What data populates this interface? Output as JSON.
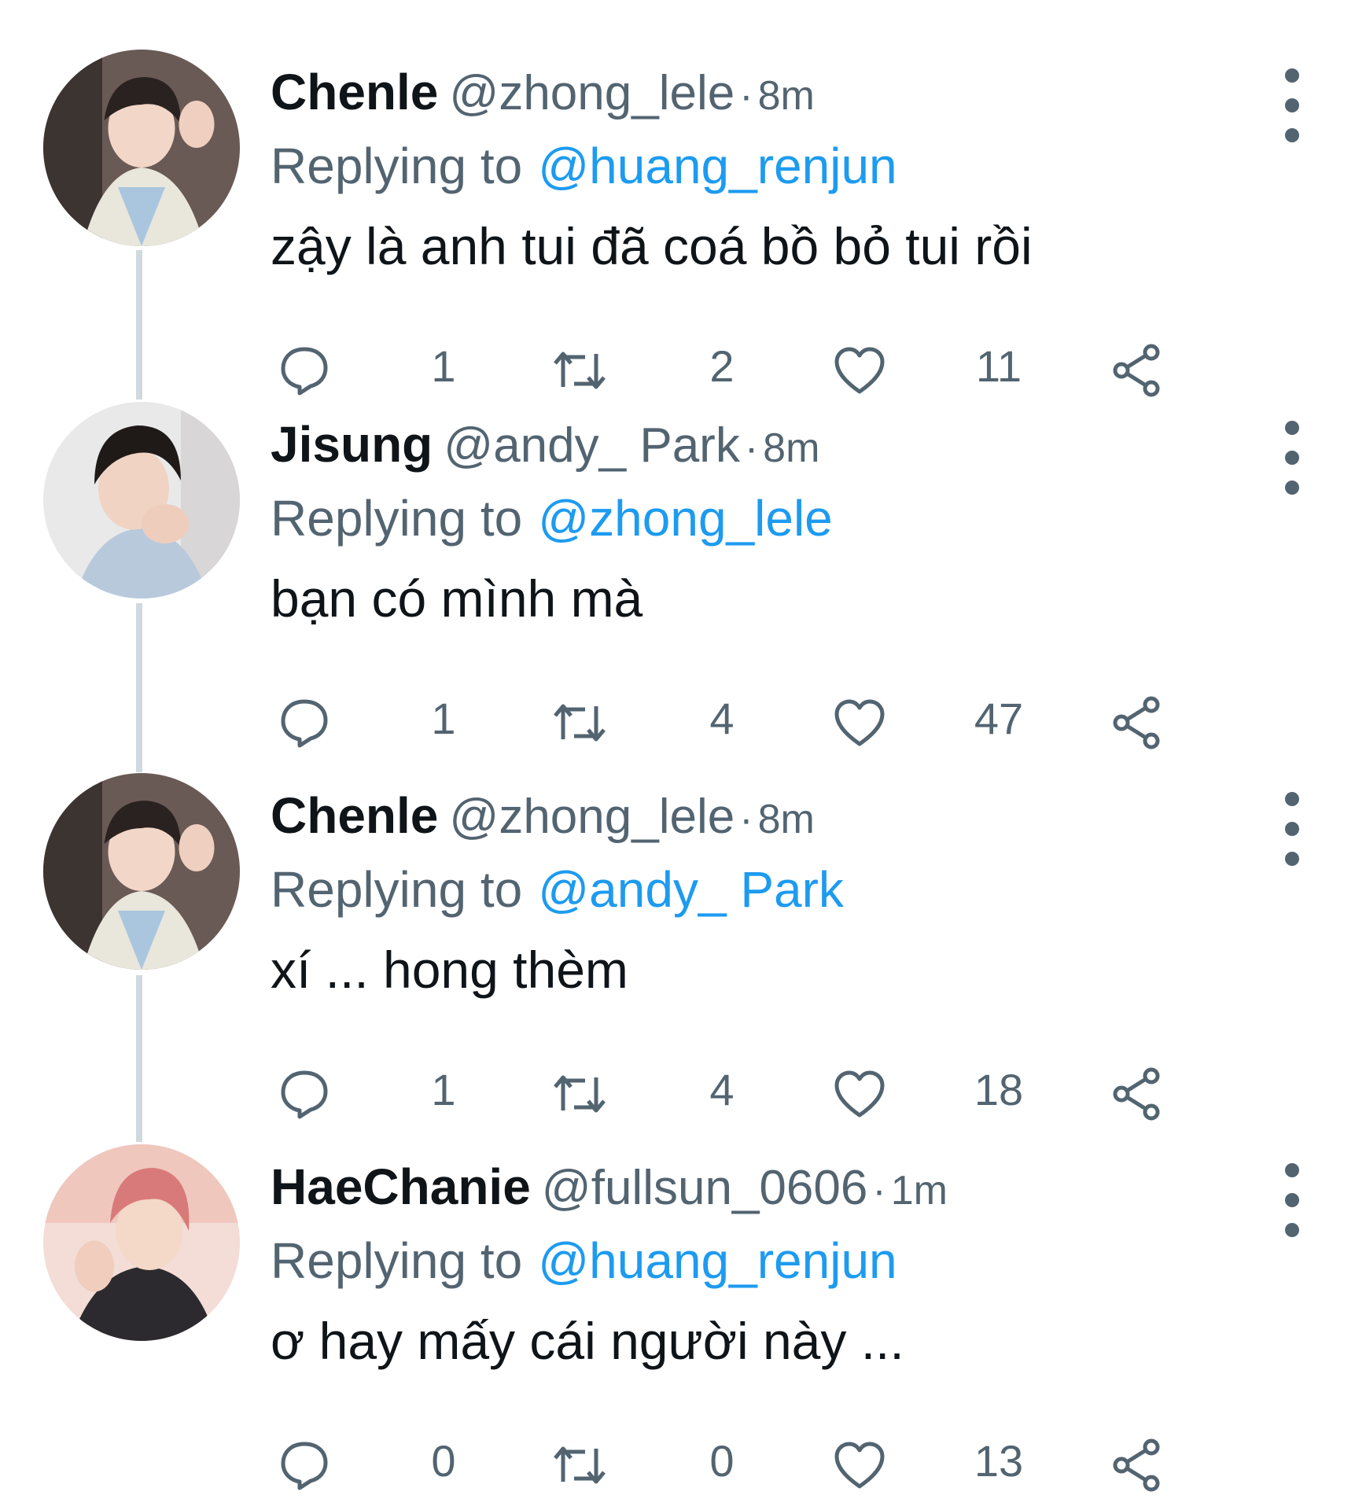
{
  "tweets": [
    {
      "name": "Chenle",
      "handle": "@zhong_lele",
      "dot": "·",
      "time": "8m",
      "replying_label": "Replying to",
      "replying_to": "@huang_renjun",
      "text": "zậy là anh tui đã coá bồ bỏ tui rồi",
      "replies": "1",
      "retweets": "2",
      "likes": "11"
    },
    {
      "name": "Jisung",
      "handle": "@andy_ Park",
      "dot": "·",
      "time": "8m",
      "replying_label": "Replying to",
      "replying_to": "@zhong_lele",
      "text": "bạn có mình mà",
      "replies": "1",
      "retweets": "4",
      "likes": "47"
    },
    {
      "name": "Chenle",
      "handle": "@zhong_lele",
      "dot": "·",
      "time": "8m",
      "replying_label": "Replying to",
      "replying_to": "@andy_ Park",
      "text": "xí ... hong thèm",
      "replies": "1",
      "retweets": "4",
      "likes": "18"
    },
    {
      "name": "HaeChanie",
      "handle": "@fullsun_0606",
      "dot": "·",
      "time": "1m",
      "replying_label": "Replying to",
      "replying_to": "@huang_renjun",
      "text": "ơ hay mấy cái người này ...",
      "replies": "0",
      "retweets": "0",
      "likes": "13"
    }
  ],
  "colors": {
    "text": "#0f1419",
    "secondary": "#536471",
    "mention": "#1d9bf0",
    "thread_line": "#cfd9de"
  },
  "icons": [
    "reply-icon",
    "retweet-icon",
    "like-icon",
    "share-icon",
    "more-options-icon"
  ]
}
